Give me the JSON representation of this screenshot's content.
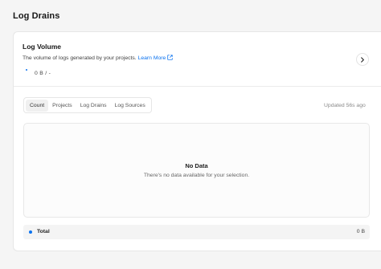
{
  "page": {
    "title": "Log Drains"
  },
  "log_volume": {
    "title": "Log Volume",
    "description": "The volume of logs generated by your projects.",
    "learn_more": "Learn More",
    "value": "0 B / -"
  },
  "tabs": [
    {
      "label": "Count",
      "active": true
    },
    {
      "label": "Projects",
      "active": false
    },
    {
      "label": "Log Drains",
      "active": false
    },
    {
      "label": "Log Sources",
      "active": false
    }
  ],
  "updated": "Updated 56s ago",
  "empty_state": {
    "title": "No Data",
    "description": "There's no data available for your selection."
  },
  "total": {
    "label": "Total",
    "value": "0 B"
  },
  "icons": {
    "external_link": "external-link-icon",
    "chevron": "chevron-right-icon"
  },
  "colors": {
    "accent": "#0a72ef",
    "background": "#f5f5f5",
    "card": "#ffffff"
  }
}
